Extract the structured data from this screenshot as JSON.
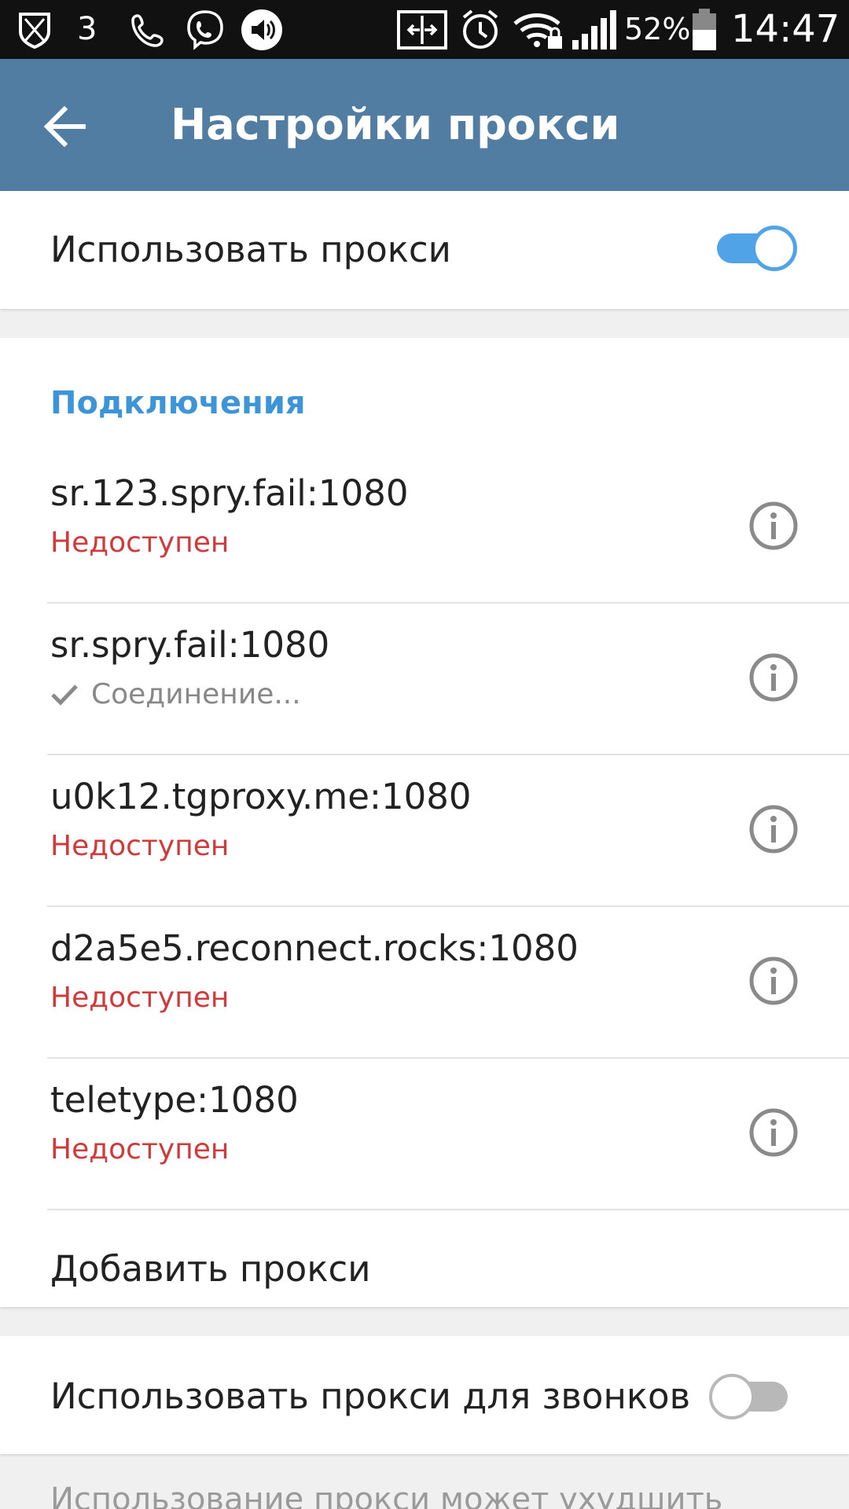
{
  "status_bar": {
    "notification_count": "3",
    "battery_percent": "52%",
    "time": "14:47",
    "icons": [
      "shield-icon",
      "phone-icon",
      "viber-icon",
      "volume-icon",
      "nfc-icon",
      "alarm-icon",
      "wifi-lock-icon",
      "signal-icon",
      "battery-icon"
    ]
  },
  "app_bar": {
    "title": "Настройки прокси",
    "back_icon": "arrow-left-icon"
  },
  "use_proxy": {
    "label": "Использовать прокси",
    "enabled": true,
    "accent_color": "#4fa3e6"
  },
  "connections": {
    "header": "Подключения",
    "items": [
      {
        "name": "sr.123.spry.fail:1080",
        "status": "Недоступен",
        "state": "unavailable"
      },
      {
        "name": "sr.spry.fail:1080",
        "status": "Соединение...",
        "state": "connecting"
      },
      {
        "name": "u0k12.tgproxy.me:1080",
        "status": "Недоступен",
        "state": "unavailable"
      },
      {
        "name": "d2a5e5.reconnect.rocks:1080",
        "status": "Недоступен",
        "state": "unavailable"
      },
      {
        "name": "teletype:1080",
        "status": "Недоступен",
        "state": "unavailable"
      }
    ],
    "add_label": "Добавить прокси"
  },
  "calls_proxy": {
    "label": "Использовать прокси для звонков",
    "enabled": false
  },
  "footer": {
    "note": "Использование прокси может ухудшить"
  },
  "colors": {
    "app_bar": "#527da3",
    "section_header": "#3d95d8",
    "unavailable": "#d13a3a",
    "connecting": "#888888"
  }
}
